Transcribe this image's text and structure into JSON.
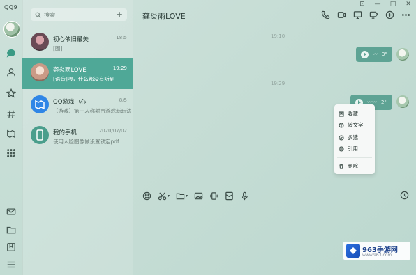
{
  "app": {
    "brand": "QQ9"
  },
  "search": {
    "placeholder": "搜索"
  },
  "conversations": [
    {
      "name": "初心依旧最美",
      "time": "18:5",
      "preview": "[图]"
    },
    {
      "name": "龚炎雨LOVE",
      "time": "19:29",
      "preview": "[语音]喂，什么都没有听到"
    },
    {
      "name": "QQ游戏中心",
      "time": "8/5",
      "preview": "【游戏】第一人称射击游戏新玩法带给..."
    },
    {
      "name": "我的手机",
      "time": "2020/07/02",
      "preview": "使用人脸图像做设置锁定pdf"
    }
  ],
  "chat": {
    "title": "龚炎雨LOVE",
    "timestamps": [
      "19:10",
      "19:29"
    ],
    "messages": [
      {
        "type": "voice",
        "duration": "3\""
      },
      {
        "type": "voice",
        "duration": "2\""
      }
    ]
  },
  "context_menu": {
    "items": [
      {
        "label": "收藏",
        "icon": "bookmark-icon"
      },
      {
        "label": "转文字",
        "icon": "convert-text-icon"
      },
      {
        "label": "多选",
        "icon": "multi-select-icon"
      },
      {
        "label": "引用",
        "icon": "quote-icon"
      },
      {
        "label": "删除",
        "icon": "trash-icon"
      }
    ]
  },
  "watermark": {
    "title": "963手游网",
    "subtitle": "www.963.com"
  },
  "colors": {
    "accent": "#4fa897",
    "bubble": "#5ea394",
    "background": "#c6ddd5"
  }
}
